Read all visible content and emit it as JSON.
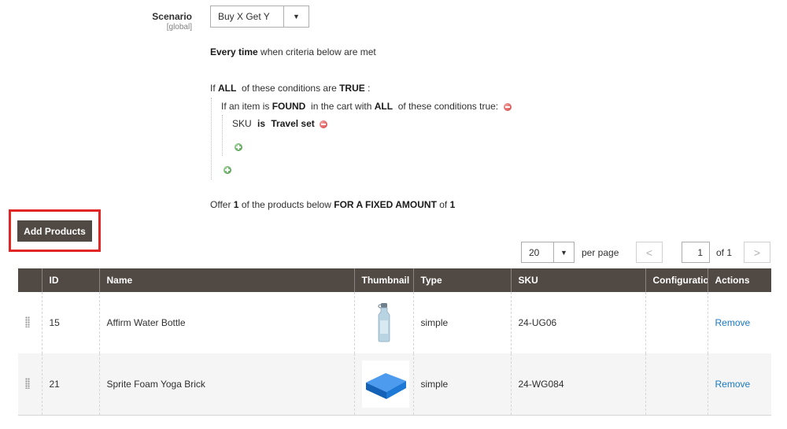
{
  "scenario": {
    "label": "Scenario",
    "scope": "[global]",
    "value": "Buy X Get Y",
    "arrow": "▼"
  },
  "rule_apply": {
    "bold": "Every time",
    "rest": " when criteria below are met"
  },
  "conditions": {
    "if_prefix": "If ",
    "aggregator": "ALL",
    "middle": "  of these conditions are ",
    "value": "TRUE",
    "suffix": " :",
    "found_line": {
      "prefix": "If an item is ",
      "found": "FOUND",
      "middle": "  in the cart with ",
      "aggregator": "ALL",
      "suffix": "  of these conditions true:"
    },
    "sku_line": {
      "attr": "SKU",
      "operator": "is",
      "value": "Travel set"
    }
  },
  "offer": {
    "prefix": "Offer ",
    "qty": "1",
    "middle": " of the products below ",
    "type": "FOR A FIXED AMOUNT",
    "of": " of ",
    "amount": "1"
  },
  "add_products_label": "Add Products",
  "pager": {
    "per_page_value": "20",
    "arrow": "▼",
    "per_page_label": "per page",
    "prev": "<",
    "current_page": "1",
    "total_label": "of 1",
    "next": ">"
  },
  "grid": {
    "columns": [
      "ID",
      "Name",
      "Thumbnail",
      "Type",
      "SKU",
      "Configuration",
      "Actions"
    ],
    "rows": [
      {
        "id": "15",
        "name": "Affirm Water Bottle",
        "thumbnail_icon": "water-bottle-icon",
        "type": "simple",
        "sku": "24-UG06",
        "configuration": "",
        "action": "Remove"
      },
      {
        "id": "21",
        "name": "Sprite Foam Yoga Brick",
        "thumbnail_icon": "yoga-brick-icon",
        "type": "simple",
        "sku": "24-WG084",
        "configuration": "",
        "action": "Remove"
      }
    ]
  },
  "colors": {
    "header_bg": "#514943",
    "link": "#1979c3",
    "highlight": "#e22626",
    "brick_blue": "#1d78d6"
  }
}
